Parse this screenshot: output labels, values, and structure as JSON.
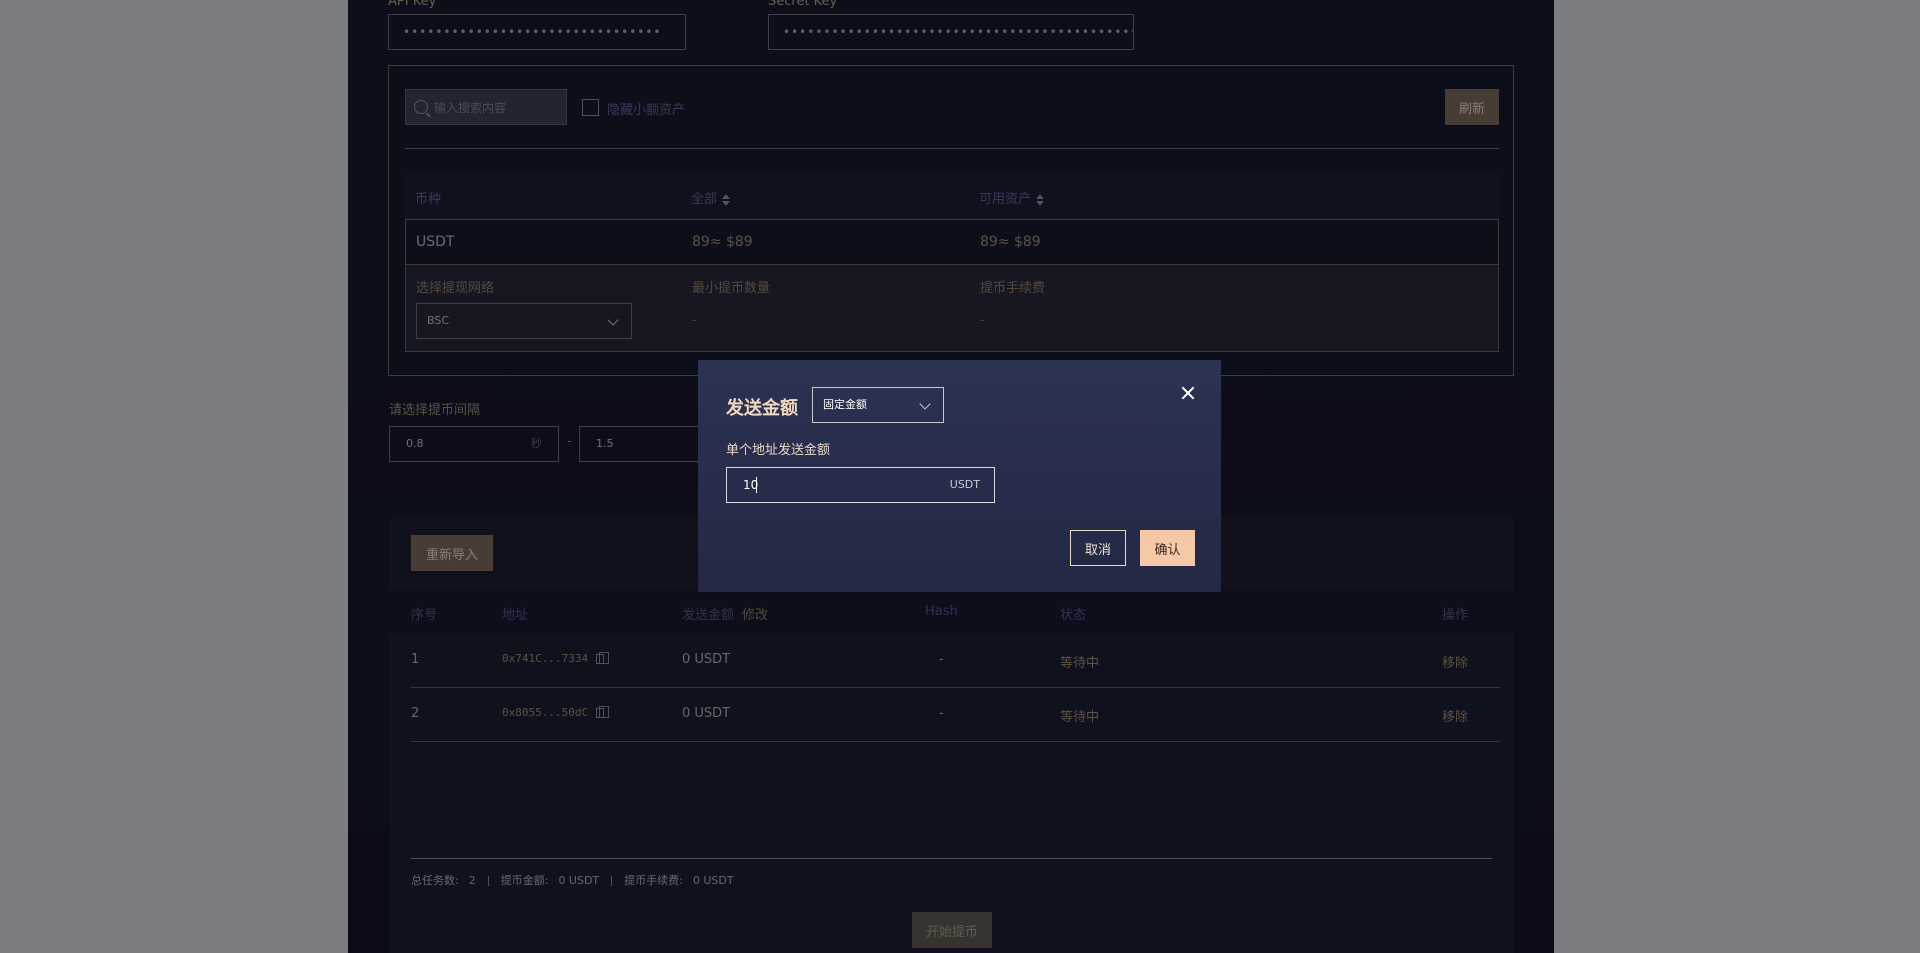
{
  "keys": {
    "api_key_label": "API Key",
    "secret_key_label": "Secret Key",
    "api_key_value": "••••••••••••••••••••••••••••••••",
    "secret_key_value": "••••••••••••••••••••••••••••••••••••••••••••••••••••••••••••••••"
  },
  "assets": {
    "search_placeholder": "输入搜索内容",
    "hide_small_label": "隐藏小额资产",
    "refresh_label": "刷新",
    "columns": {
      "coin": "币种",
      "total": "全部",
      "available": "可用资产"
    },
    "row": {
      "coin": "USDT",
      "total": "89≈ $89",
      "available": "89≈ $89"
    },
    "detail": {
      "network_label": "选择提现网络",
      "network_value": "BSC",
      "min_label": "最小提币数量",
      "min_value": "-",
      "fee_label": "提币手续费",
      "fee_value": "-"
    }
  },
  "interval": {
    "label": "请选择提币间隔",
    "min": "0.8",
    "max": "1.5",
    "unit": "秒",
    "dash": "-"
  },
  "tasks": {
    "reimport_label": "重新导入",
    "columns": {
      "no": "序号",
      "address": "地址",
      "amount": "发送金额",
      "edit": "修改",
      "hash": "Hash",
      "status": "状态",
      "action": "操作"
    },
    "rows": [
      {
        "no": "1",
        "address": "0x741C...7334",
        "amount": "0 USDT",
        "hash": "-",
        "status": "等待中",
        "action": "移除"
      },
      {
        "no": "2",
        "address": "0x8055...50dC",
        "amount": "0 USDT",
        "hash": "-",
        "status": "等待中",
        "action": "移除"
      }
    ],
    "summary": {
      "total_label": "总任务数:",
      "total_value": "2",
      "amount_label": "提币金额:",
      "amount_value": "0 USDT",
      "fee_label": "提币手续费:",
      "fee_value": "0 USDT"
    },
    "start_label": "开始提币"
  },
  "modal": {
    "title": "发送金额",
    "mode": "固定金额",
    "amount_label": "单个地址发送金额",
    "amount_value": "10",
    "amount_unit": "USDT",
    "cancel_label": "取消",
    "confirm_label": "确认"
  }
}
